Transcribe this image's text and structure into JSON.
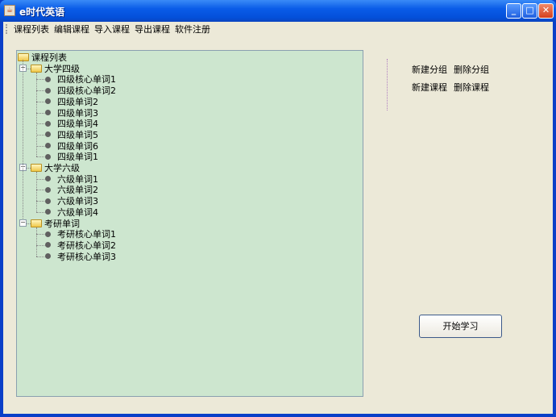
{
  "window": {
    "title": "e时代英语"
  },
  "menu": [
    "课程列表",
    "编辑课程",
    "导入课程",
    "导出课程",
    "软件注册"
  ],
  "tree": {
    "root": "课程列表",
    "groups": [
      {
        "label": "大学四级",
        "items": [
          "四级核心单词1",
          "四级核心单词2",
          "四级单词2",
          "四级单词3",
          "四级单词4",
          "四级单词5",
          "四级单词6",
          "四级单词1"
        ]
      },
      {
        "label": "大学六级",
        "items": [
          "六级单词1",
          "六级单词2",
          "六级单词3",
          "六级单词4"
        ]
      },
      {
        "label": "考研单词",
        "items": [
          "考研核心单词1",
          "考研核心单词2",
          "考研核心单词3"
        ]
      }
    ]
  },
  "actions": {
    "new_group": "新建分组",
    "delete_group": "删除分组",
    "new_course": "新建课程",
    "delete_course": "删除课程"
  },
  "start_button": "开始学习"
}
